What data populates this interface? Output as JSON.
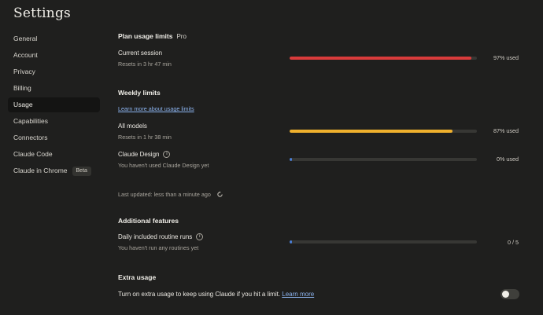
{
  "page": {
    "title": "Settings"
  },
  "sidebar": {
    "items": [
      {
        "label": "General",
        "active": false
      },
      {
        "label": "Account",
        "active": false
      },
      {
        "label": "Privacy",
        "active": false
      },
      {
        "label": "Billing",
        "active": false
      },
      {
        "label": "Usage",
        "active": true
      },
      {
        "label": "Capabilities",
        "active": false
      },
      {
        "label": "Connectors",
        "active": false
      },
      {
        "label": "Claude Code",
        "active": false
      },
      {
        "label": "Claude in Chrome",
        "active": false,
        "badge": "Beta"
      }
    ]
  },
  "plan": {
    "title": "Plan usage limits",
    "tier": "Pro",
    "current_session": {
      "label": "Current session",
      "reset": "Resets in 3 hr 47 min",
      "percent": 97,
      "usage_text": "97% used",
      "color": "#d93b3b"
    }
  },
  "weekly": {
    "title": "Weekly limits",
    "learn_more": "Learn more about usage limits",
    "all_models": {
      "label": "All models",
      "reset": "Resets in 1 hr 38 min",
      "percent": 87,
      "usage_text": "87% used",
      "color": "#efb02d"
    },
    "claude_design": {
      "label": "Claude Design",
      "note": "You haven't used Claude Design yet",
      "percent": 0,
      "usage_text": "0% used",
      "color": "#4a7fd8"
    },
    "last_updated": "Last updated: less than a minute ago"
  },
  "additional": {
    "title": "Additional features",
    "routines": {
      "label": "Daily included routine runs",
      "note": "You haven't run any routines yet",
      "used": 0,
      "total": 5,
      "usage_text": "0 / 5",
      "color": "#4a7fd8"
    }
  },
  "extra": {
    "title": "Extra usage",
    "description": "Turn on extra usage to keep using Claude if you hit a limit.",
    "link": "Learn more",
    "enabled": false
  },
  "icons": {
    "info": "info-icon",
    "refresh": "refresh-icon"
  }
}
